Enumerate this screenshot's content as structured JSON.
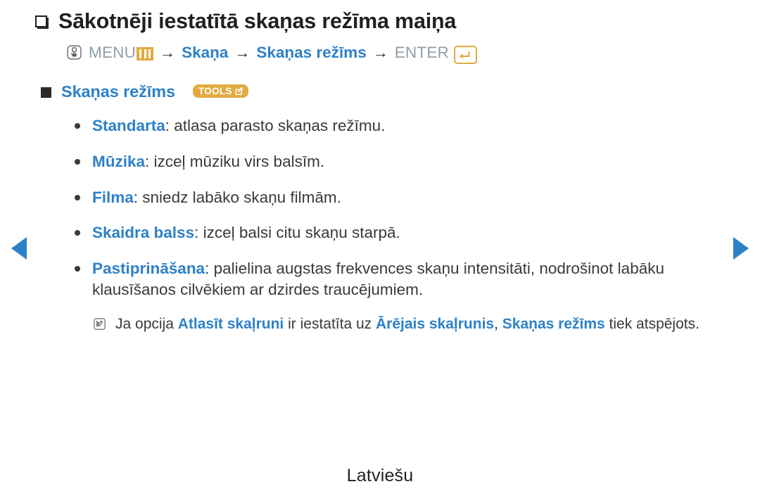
{
  "title": {
    "marker_icon": "shadow-square-icon",
    "text": "Sākotnēji iestatītā skaņas režīma maiņa"
  },
  "menu_path": {
    "hand_icon": "hand-press-icon",
    "menu_label": "MENU",
    "menu_bars_icon": "menu-bars-icon",
    "arrow1": "→",
    "step1": "Skaņa",
    "arrow2": "→",
    "step2": "Skaņas režīms",
    "arrow3": "→",
    "enter_label": "ENTER",
    "enter_icon": "enter-return-icon"
  },
  "section": {
    "marker_icon": "filled-square-icon",
    "heading": "Skaņas režīms",
    "badge_label": "TOOLS",
    "badge_icon": "tools-arrow-icon"
  },
  "bullets": [
    {
      "term": "Standarta",
      "sep": ": ",
      "desc": "atlasa parasto skaņas režīmu."
    },
    {
      "term": "Mūzika",
      "sep": ": ",
      "desc": "izceļ mūziku virs balsīm."
    },
    {
      "term": "Filma",
      "sep": ": ",
      "desc": "sniedz labāko skaņu filmām."
    },
    {
      "term": "Skaidra balss",
      "sep": ": ",
      "desc": "izceļ balsi citu skaņu starpā."
    },
    {
      "term": "Pastiprināšana",
      "sep": ": ",
      "desc": "palielina augstas frekvences skaņu intensitāti, nodrošinot labāku klausīšanos cilvēkiem ar dzirdes traucējumiem."
    }
  ],
  "note": {
    "icon": "note-pen-icon",
    "part1": "Ja opcija ",
    "link1": "Atlasīt skaļruni",
    "part2": " ir iestatīta uz ",
    "link2": "Ārējais skaļrunis",
    "part3": ", ",
    "link3": "Skaņas režīms",
    "part4": " tiek atspējots."
  },
  "nav": {
    "prev_icon": "prev-page-arrow-icon",
    "next_icon": "next-page-arrow-icon"
  },
  "footer": {
    "language": "Latviešu"
  },
  "colors": {
    "link_blue": "#2d81c8",
    "accent_amber": "#e2ab3f",
    "muted_gray": "#8f9ea8",
    "body_text": "#3a3a3a"
  }
}
